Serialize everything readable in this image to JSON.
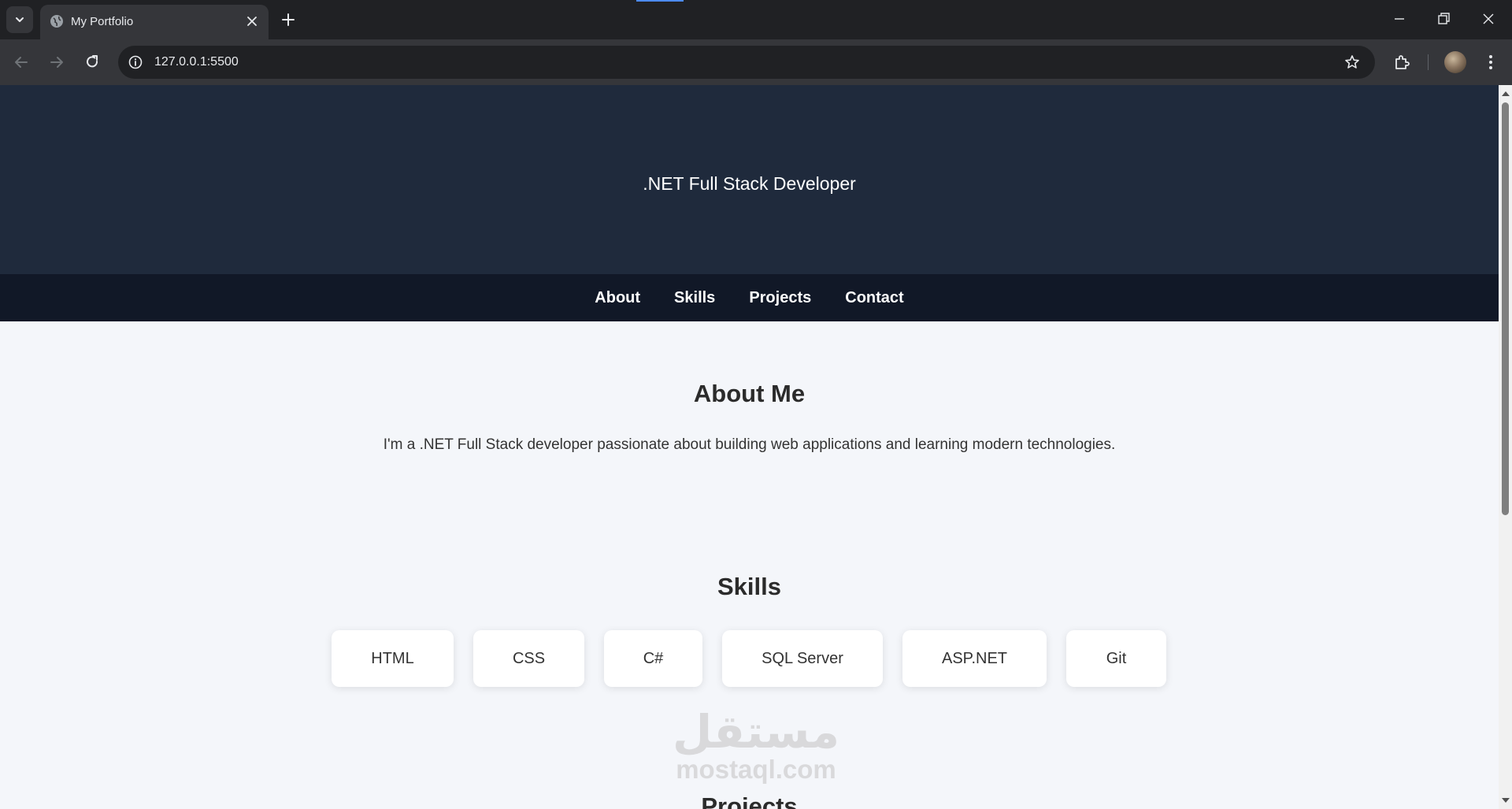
{
  "browser": {
    "tab_title": "My Portfolio",
    "url": "127.0.0.1:5500",
    "accent_color": "#4c8bf5",
    "icons": [
      "tab-search-icon",
      "globe-icon",
      "close-icon",
      "plus-icon",
      "minimize-icon",
      "restore-icon",
      "window-close-icon",
      "back-icon",
      "forward-icon",
      "reload-icon",
      "info-icon",
      "star-icon",
      "extensions-icon",
      "avatar",
      "more-vert-icon"
    ]
  },
  "page": {
    "hero": {
      "tagline": ".NET Full Stack Developer",
      "background": "#1f2a3c"
    },
    "nav": {
      "items": [
        "About",
        "Skills",
        "Projects",
        "Contact"
      ],
      "background": "#111827"
    },
    "about": {
      "title": "About Me",
      "text": "I'm a .NET Full Stack developer passionate about building web applications and learning modern technologies."
    },
    "skills": {
      "title": "Skills",
      "items": [
        "HTML",
        "CSS",
        "C#",
        "SQL Server",
        "ASP.NET",
        "Git"
      ]
    },
    "watermark": {
      "arabic": "مستقل",
      "latin": "mostaql.com"
    },
    "next_section_title": "Projects"
  }
}
